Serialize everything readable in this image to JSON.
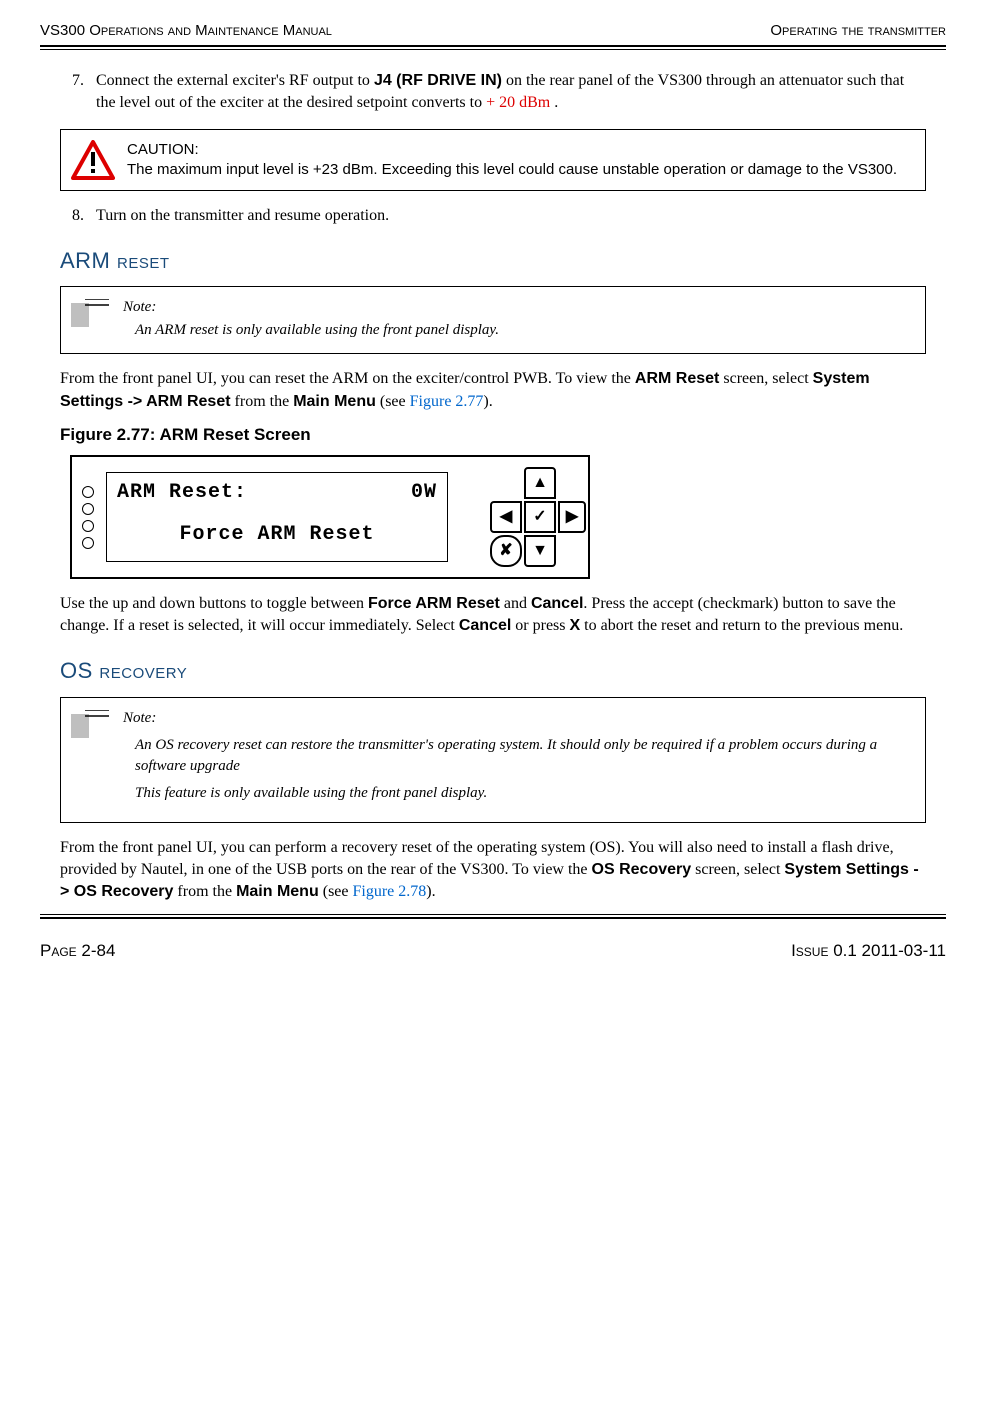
{
  "header": {
    "left": "VS300 Operations and Maintenance Manual",
    "right": "Operating the transmitter"
  },
  "step7": {
    "num": "7.",
    "textA": "Connect the external exciter's RF output to ",
    "bold1": "J4 (RF DRIVE IN)",
    "textB": " on the rear panel of the VS300 through an attenuator such that the level out of the exciter at the desired setpoint converts to ",
    "red": "+ 20 dBm ",
    "textC": "."
  },
  "caution": {
    "label": "CAUTION:",
    "body": "The maximum input level is +23 dBm. Exceeding this level could cause unstable operation or damage to the VS300."
  },
  "step8": {
    "num": "8.",
    "text": "Turn on the transmitter and resume operation."
  },
  "arm": {
    "heading": "ARM reset",
    "note_label": "Note:",
    "note_body": "An ARM reset is only available using the front panel display.",
    "para_a": "From the front panel UI, you can reset the ARM on the exciter/control PWB. To view the ",
    "bold1": "ARM Reset",
    "para_b": " screen, select ",
    "bold2": "System Settings -> ARM Reset",
    "para_c": " from the ",
    "bold3": "Main Menu",
    "para_d": " (see ",
    "link": "Figure 2.77",
    "para_e": ").",
    "fig_caption": "Figure 2.77: ARM Reset Screen",
    "lcd_title": "ARM Reset:",
    "lcd_value": "0W",
    "lcd_option": "Force ARM Reset",
    "desc_a": "Use the up and down buttons to toggle between ",
    "dbold1": "Force ARM Reset",
    "desc_b": " and ",
    "dbold2": "Cancel",
    "desc_c": ". Press the accept (checkmark) button to save the change. If a reset is selected, it will occur immediately. Select ",
    "dbold3": "Cancel",
    "desc_d": " or press ",
    "dbold4": "X",
    "desc_e": " to abort the reset and return to the previous menu."
  },
  "os": {
    "heading": "OS recovery",
    "note_label": "Note:",
    "note_body1": "An OS recovery reset can restore the transmitter's operating system. It should only be required if a problem occurs during a software upgrade",
    "note_body2": "This feature is only available using the front panel display.",
    "para_a": "From the front panel UI, you can perform a recovery reset of the operating system (OS). You will also need to install a flash drive, provided by Nautel, in one of the USB ports on the rear of the VS300. To view the ",
    "bold1": "OS Recovery",
    "para_b": " screen, select ",
    "bold2": "System Settings -> OS Recovery",
    "para_c": " from the ",
    "bold3": "Main Menu",
    "para_d": " (see ",
    "link": "Figure 2.78",
    "para_e": ")."
  },
  "footer": {
    "left": "Page 2-84",
    "right": "Issue 0.1  2011-03-11"
  }
}
